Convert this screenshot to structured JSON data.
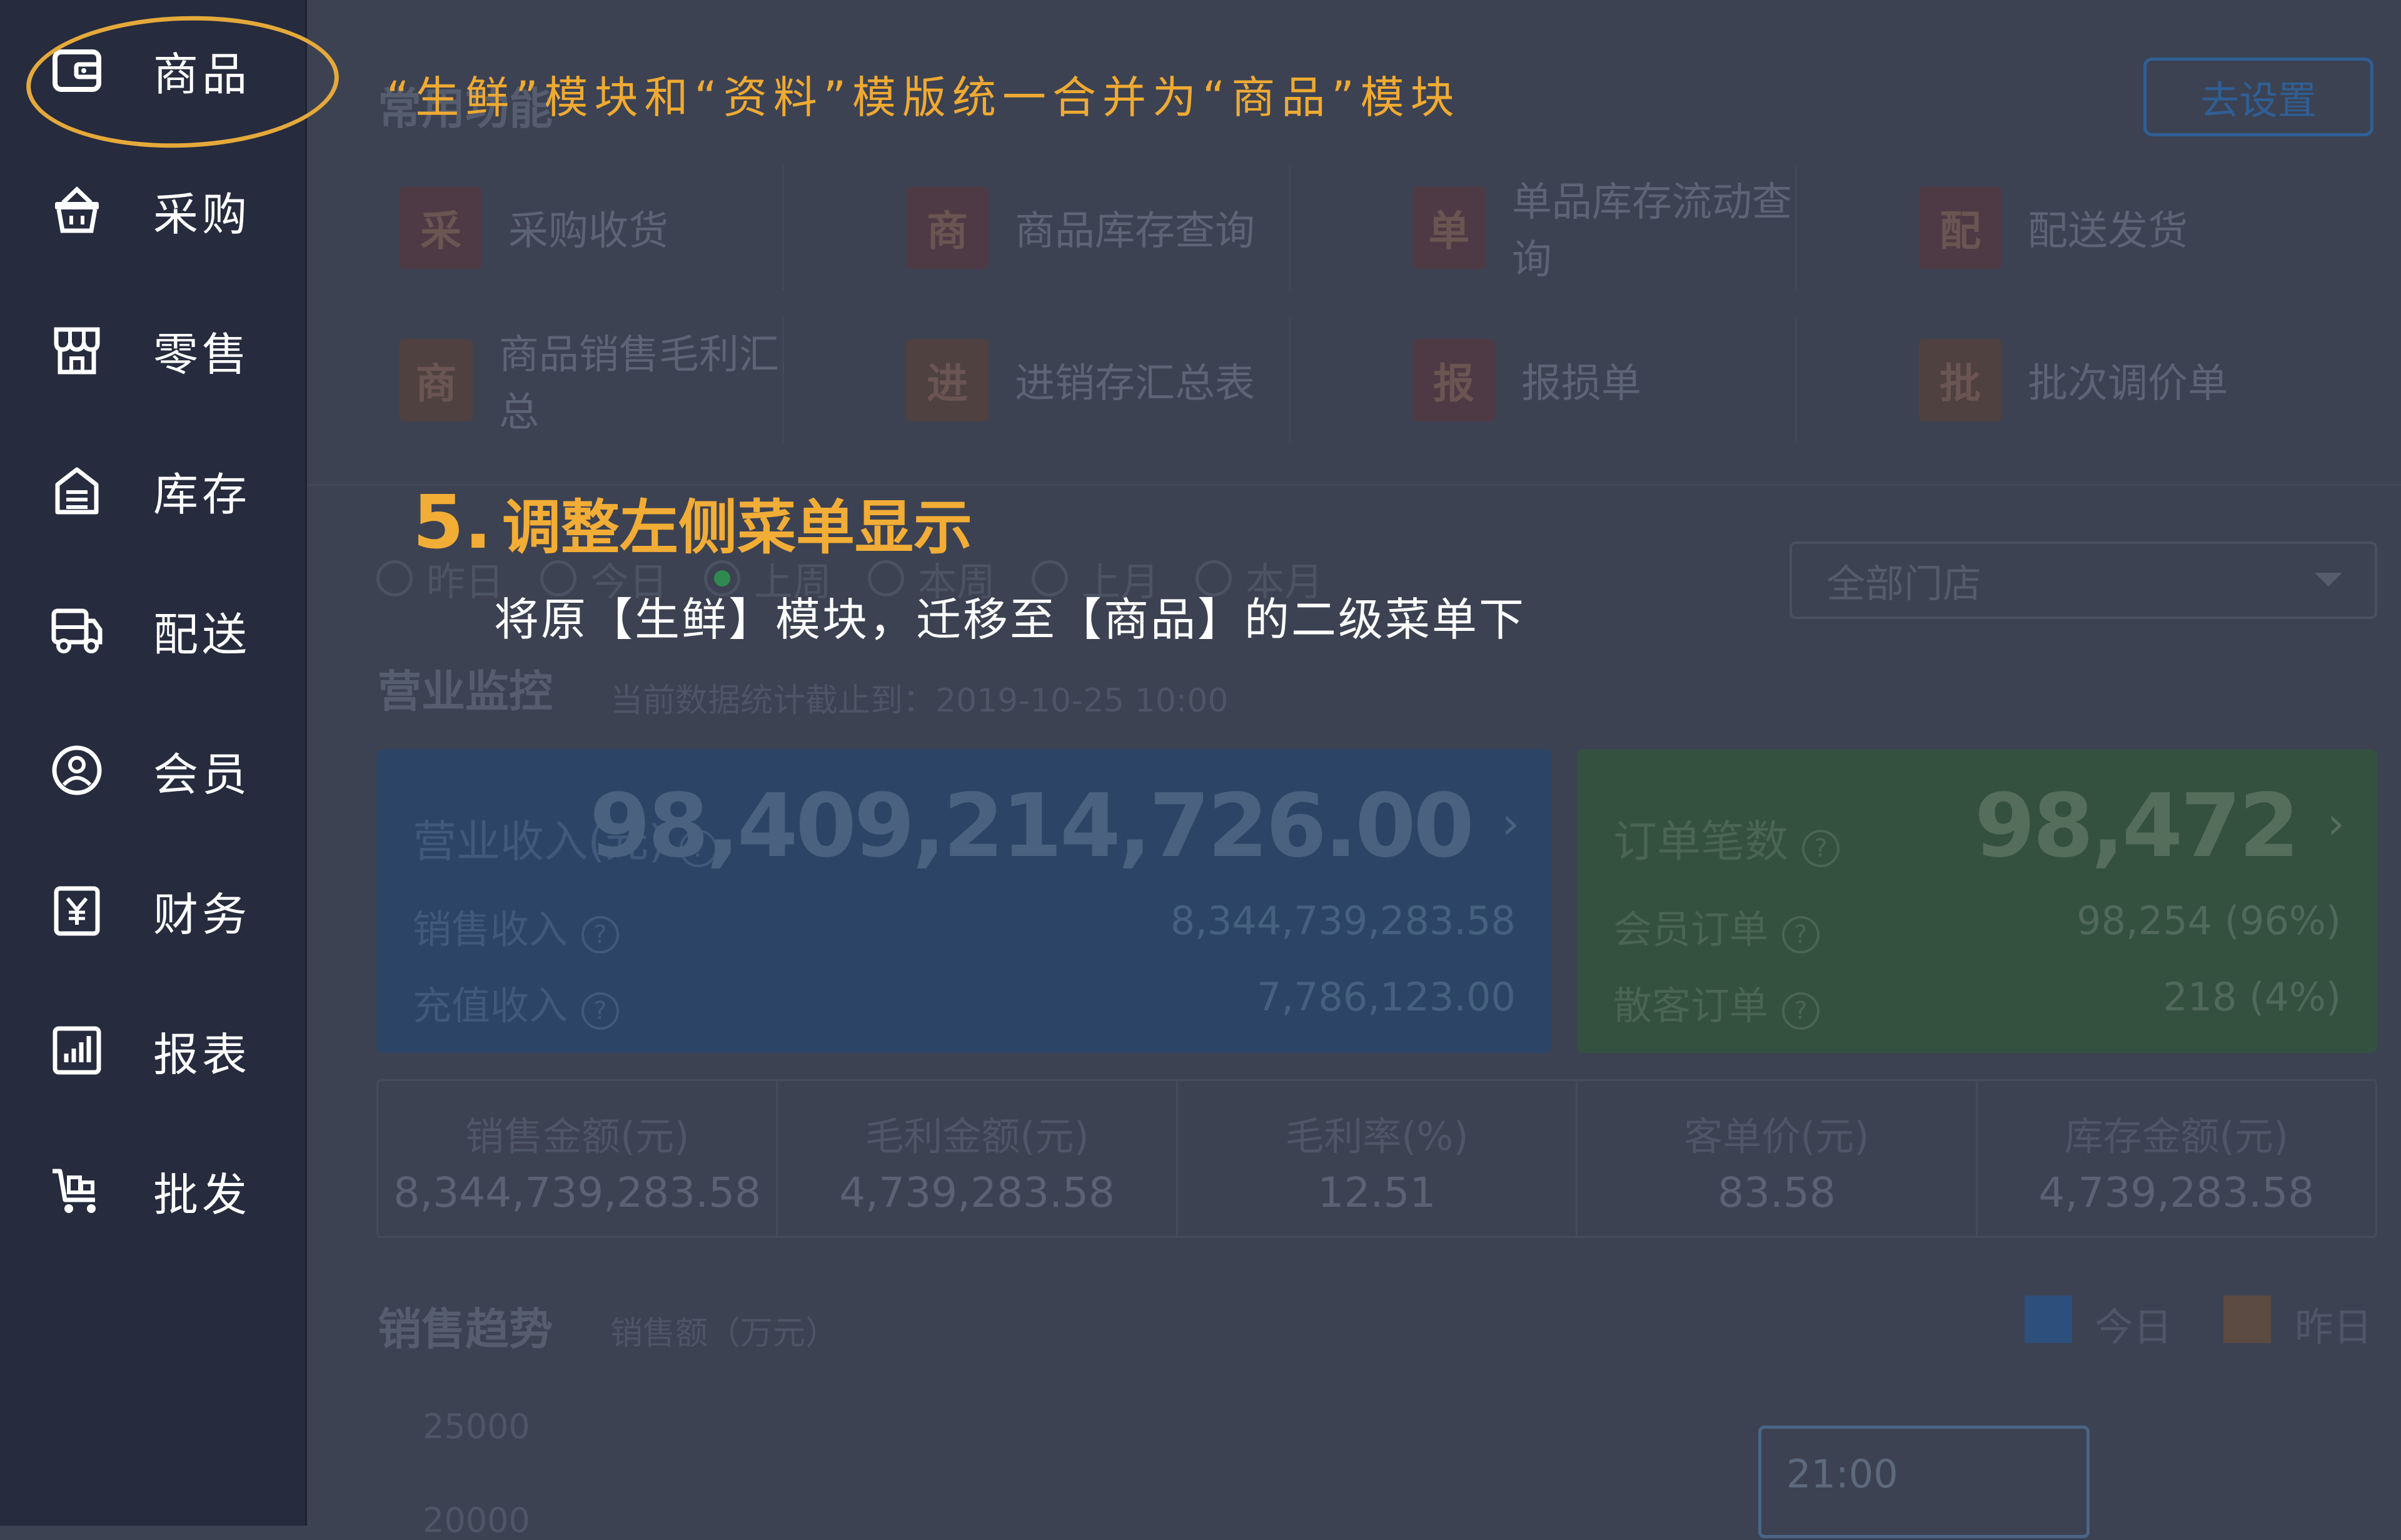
{
  "sidebar": {
    "items": [
      {
        "label": "商品",
        "icon": "wallet-icon"
      },
      {
        "label": "采购",
        "icon": "basket-icon"
      },
      {
        "label": "零售",
        "icon": "store-icon"
      },
      {
        "label": "库存",
        "icon": "warehouse-icon"
      },
      {
        "label": "配送",
        "icon": "truck-icon"
      },
      {
        "label": "会员",
        "icon": "member-icon"
      },
      {
        "label": "财务",
        "icon": "yuan-icon"
      },
      {
        "label": "报表",
        "icon": "report-icon"
      },
      {
        "label": "批发",
        "icon": "cart-icon"
      }
    ]
  },
  "annotations": {
    "top_note": "“生鲜”模块和“资料”模版统一合并为“商品”模块",
    "step_number": "5.",
    "step_title": "调整左侧菜单显示",
    "step_desc": "将原【生鲜】模块，迁移至【商品】的二级菜单下"
  },
  "common_functions": {
    "title": "常用功能",
    "setup_button": "去设置",
    "items": [
      {
        "badge": "采",
        "label": "采购收货"
      },
      {
        "badge": "商",
        "label": "商品库存查询"
      },
      {
        "badge": "单",
        "label": "单品库存流动查询"
      },
      {
        "badge": "配",
        "label": "配送发货"
      },
      {
        "badge": "商",
        "label": "商品销售毛利汇总"
      },
      {
        "badge": "进",
        "label": "进销存汇总表"
      },
      {
        "badge": "报",
        "label": "报损单"
      },
      {
        "badge": "批",
        "label": "批次调价单"
      }
    ]
  },
  "period_filter": {
    "options": [
      "昨日",
      "今日",
      "上周",
      "本周",
      "上月",
      "本月"
    ],
    "selected": "上周"
  },
  "store_select": {
    "value": "全部门店"
  },
  "monitor": {
    "title": "营业监控",
    "note": "当前数据统计截止到：2019-10-25 10:00"
  },
  "revenue_card": {
    "title": "营业收入(元)",
    "total": "98,409,214,726.00",
    "rows": [
      {
        "label": "销售收入",
        "value": "8,344,739,283.58"
      },
      {
        "label": "充值收入",
        "value": "7,786,123.00"
      }
    ]
  },
  "order_card": {
    "title": "订单笔数",
    "total": "98,472",
    "rows": [
      {
        "label": "会员订单",
        "value": "98,254 (96%)"
      },
      {
        "label": "散客订单",
        "value": "218 (4%)"
      }
    ]
  },
  "stats": [
    {
      "label": "销售金额(元)",
      "value": "8,344,739,283.58"
    },
    {
      "label": "毛利金额(元)",
      "value": "4,739,283.58"
    },
    {
      "label": "毛利率(%)",
      "value": "12.51"
    },
    {
      "label": "客单价(元)",
      "value": "83.58"
    },
    {
      "label": "库存金额(元)",
      "value": "4,739,283.58"
    }
  ],
  "trend": {
    "title": "销售趋势",
    "unit_note": "销售额（万元）",
    "legend": [
      {
        "label": "今日",
        "color": "#2d4f7c"
      },
      {
        "label": "昨日",
        "color": "#5c4b42"
      }
    ],
    "y_ticks": [
      "25000",
      "20000"
    ],
    "tooltip_time": "21:00"
  },
  "colors": {
    "accent_orange": "#efaa32",
    "sidebar_bg": "#262b3e",
    "dim_bg": "#3c4252"
  }
}
